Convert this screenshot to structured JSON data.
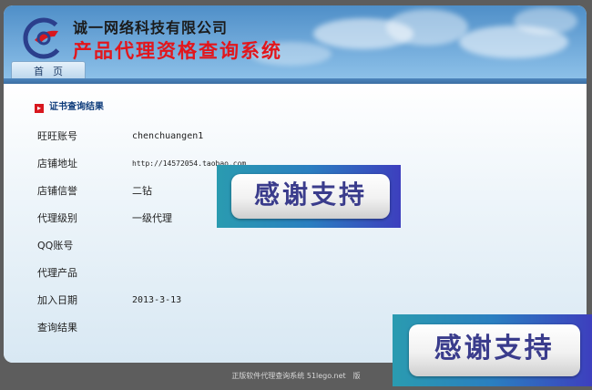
{
  "header": {
    "company_name": "诚一网络科技有限公司",
    "system_name": "产品代理资格查询系统"
  },
  "nav": {
    "tabs": [
      {
        "label": "首页"
      }
    ]
  },
  "result": {
    "section_title": "证书查询结果",
    "rows": [
      {
        "label": "旺旺账号",
        "value": "chenchuangen1"
      },
      {
        "label": "店铺地址",
        "value": "http://14572054.taobao.com"
      },
      {
        "label": "店铺信誉",
        "value": "二钻"
      },
      {
        "label": "代理级别",
        "value": "一级代理"
      },
      {
        "label": "QQ账号",
        "value": ""
      },
      {
        "label": "代理产品",
        "value": ""
      },
      {
        "label": "加入日期",
        "value": "2013-3-13"
      },
      {
        "label": "查询结果",
        "value": ""
      }
    ]
  },
  "overlay": {
    "thanks_text": "感谢支持"
  },
  "footer": {
    "text": "正版软件代理查询系统 51lego.net　版"
  },
  "colors": {
    "brand_red": "#e2161c",
    "brand_blue": "#0d3b7a",
    "banner_sky": "#6ba5d7"
  }
}
